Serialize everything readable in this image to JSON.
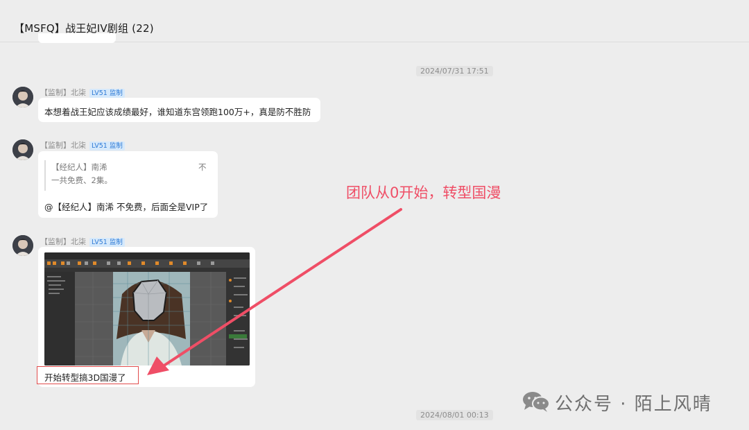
{
  "header": {
    "title": "【MSFQ】战王妃IV剧组 (22)"
  },
  "timestamps": [
    "2024/07/31 17:51",
    "2024/08/01 00:13"
  ],
  "messages": [
    {
      "sender": "【监制】北柒",
      "level_badge": "LV51 监制",
      "text": "本想着战王妃应该成绩最好，谁知道东宫领跑100万+，真是防不胜防"
    },
    {
      "sender": "【监制】北柒",
      "level_badge": "LV51 监制",
      "quote": {
        "name": "【经纪人】南浠",
        "text": "一共免费、2集。",
        "more": "不"
      },
      "text": "@【经纪人】南浠 不免费，后面全是VIP了"
    },
    {
      "sender": "【监制】北柒",
      "level_badge": "LV51 监制",
      "image_icon": "3d-modeling-software-screenshot",
      "text": "开始转型搞3D国漫了"
    }
  ],
  "annotation": {
    "text": "团队从0开始，转型国漫",
    "color": "#ef4e66"
  },
  "watermark": {
    "text": "公众号 · 陌上风晴",
    "icon": "wechat-icon"
  },
  "colors": {
    "background": "#ededed",
    "bubble": "#ffffff",
    "badge": "#2f7bd6",
    "highlight": "#e14b4b"
  }
}
